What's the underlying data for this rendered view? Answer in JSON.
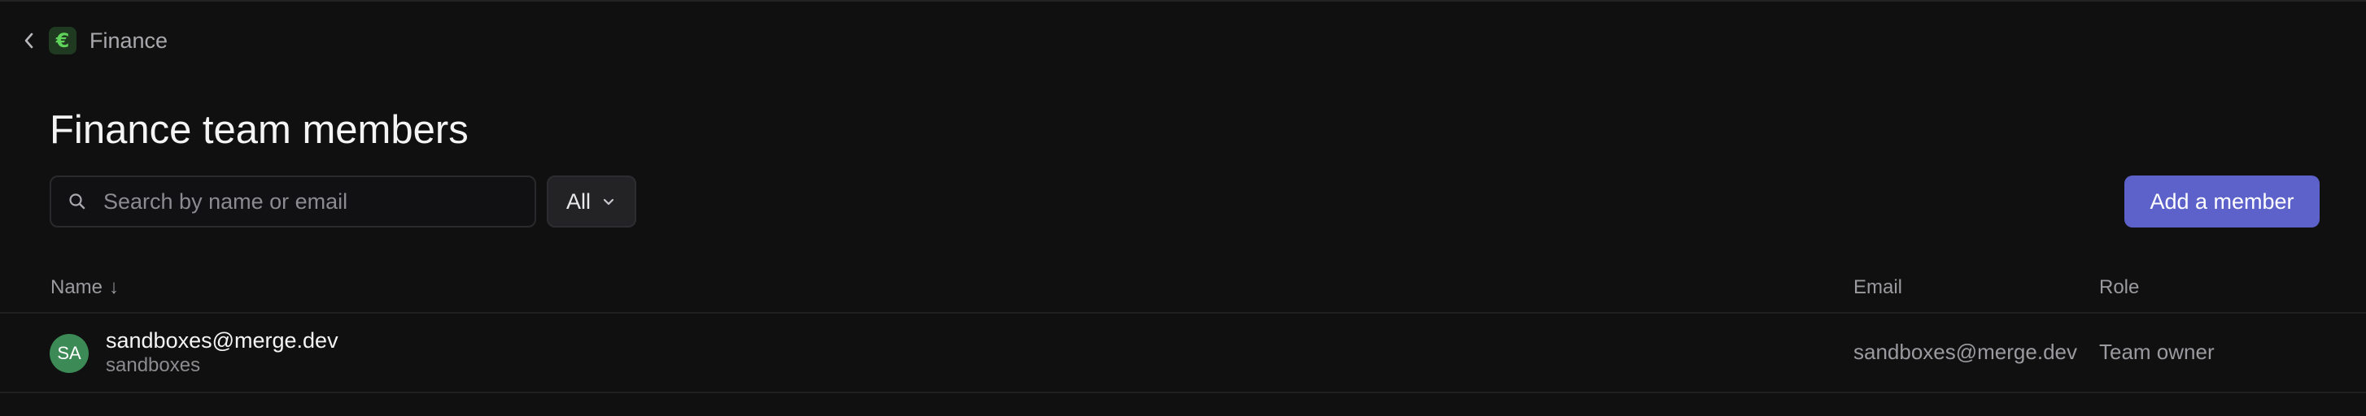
{
  "breadcrumb": {
    "team_name": "Finance",
    "team_icon_glyph": "€",
    "team_icon_color": "#5fd35a"
  },
  "page": {
    "title": "Finance team members"
  },
  "toolbar": {
    "search_placeholder": "Search by name or email",
    "search_value": "",
    "filter_value": "All",
    "add_member_label": "Add a member",
    "accent_color": "#5c62c9"
  },
  "table": {
    "columns": {
      "name": "Name",
      "name_sort": "↓",
      "email": "Email",
      "role": "Role"
    },
    "rows": [
      {
        "avatar_initials": "SA",
        "avatar_color": "#3c8a56",
        "primary": "sandboxes@merge.dev",
        "secondary": "sandboxes",
        "email": "sandboxes@merge.dev",
        "role": "Team owner"
      }
    ]
  }
}
